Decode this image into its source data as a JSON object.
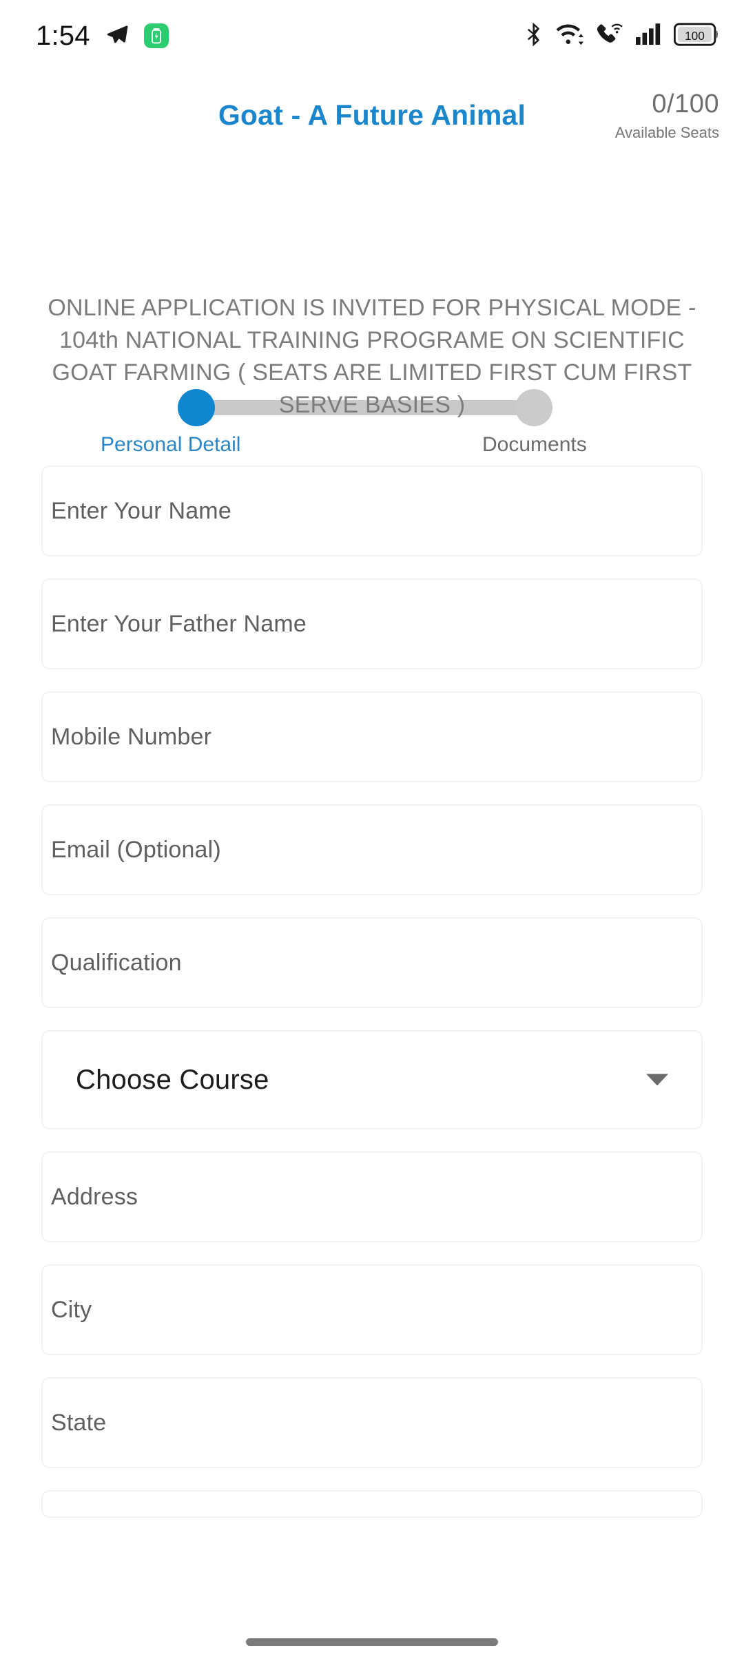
{
  "status_bar": {
    "time": "1:54",
    "battery_level": "100",
    "icons": [
      "telegram-send-icon",
      "battery-charging-badge-icon",
      "bluetooth-icon",
      "wifi-icon",
      "wifi-calling-icon",
      "cellular-signal-icon",
      "battery-icon"
    ]
  },
  "header": {
    "app_title": "Goat - A Future Animal",
    "seats_count": "0/100",
    "seats_label": "Available Seats",
    "title_color": "#1a86cc"
  },
  "stepper": {
    "active_color": "#0f86ce",
    "inactive_color": "#cbcbcb",
    "steps": [
      {
        "label": "Personal Detail",
        "state": "active"
      },
      {
        "label": "Documents",
        "state": "inactive"
      }
    ]
  },
  "description": "ONLINE APPLICATION IS  INVITED FOR PHYSICAL MODE -  104th NATIONAL TRAINING PROGRAME ON SCIENTIFIC GOAT FARMING ( SEATS ARE LIMITED FIRST CUM FIRST SERVE BASIES )",
  "form": {
    "fields": [
      {
        "name": "name-field",
        "placeholder": "Enter Your Name",
        "value": "",
        "type": "text"
      },
      {
        "name": "father-name-field",
        "placeholder": "Enter Your Father Name",
        "value": "",
        "type": "text"
      },
      {
        "name": "mobile-field",
        "placeholder": "Mobile Number",
        "value": "",
        "type": "tel"
      },
      {
        "name": "email-field",
        "placeholder": "Email (Optional)",
        "value": "",
        "type": "email"
      },
      {
        "name": "qualification-field",
        "placeholder": "Qualification",
        "value": "",
        "type": "text"
      },
      {
        "name": "course-select",
        "placeholder": "Choose Course",
        "value": "Choose Course",
        "type": "select"
      },
      {
        "name": "address-field",
        "placeholder": "Address",
        "value": "",
        "type": "text"
      },
      {
        "name": "city-field",
        "placeholder": "City",
        "value": "",
        "type": "text"
      },
      {
        "name": "state-field",
        "placeholder": "State",
        "value": "",
        "type": "text"
      }
    ]
  },
  "nav_bar": {
    "gesture_pill": "home-gesture-pill"
  }
}
